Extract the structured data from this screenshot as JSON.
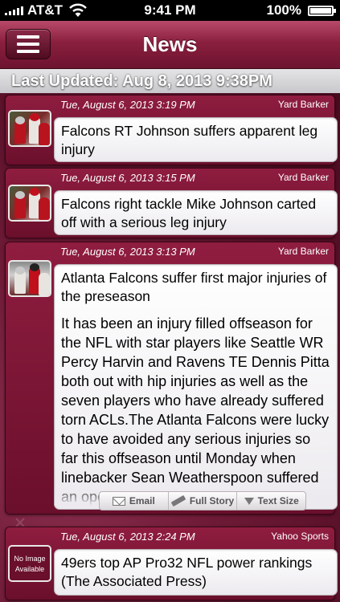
{
  "status_bar": {
    "carrier": "AT&T",
    "time": "9:41 PM",
    "battery": "100%"
  },
  "nav": {
    "title": "News",
    "menu_icon": "hamburger-icon"
  },
  "updated": {
    "text": "Last Updated: Aug 8, 2013 9:38PM"
  },
  "articles": [
    {
      "date": "Tue, August 6, 2013 3:19 PM",
      "source": "Yard Barker",
      "headline": "Falcons RT Johnson suffers apparent leg injury"
    },
    {
      "date": "Tue, August 6, 2013 3:15 PM",
      "source": "Yard Barker",
      "headline": "Falcons right tackle Mike Johnson carted off with a serious leg injury"
    },
    {
      "date": "Tue, August 6, 2013 3:13 PM",
      "source": "Yard Barker",
      "headline": "Atlanta Falcons suffer first major injuries of the preseason",
      "body": "It has been an injury filled offseason for the NFL with star players like Seattle WR Percy Harvin and Ravens TE Dennis Pitta both out with hip injuries as well as the seven players who have already suffered torn ACLs.The Atlanta Falcons were lucky to have avoided any serious injuries so far this offseason until Monday when linebacker Sean Weatherspoon suffered an open"
    },
    {
      "date": "Tue, August 6, 2013 2:24 PM",
      "source": "Yahoo Sports",
      "headline": "49ers top AP Pro32 NFL power rankings (The Associated Press)",
      "thumb_text": "No Image Available"
    }
  ],
  "toolbar": {
    "email": "Email",
    "full_story": "Full Story",
    "text_size": "Text Size"
  }
}
